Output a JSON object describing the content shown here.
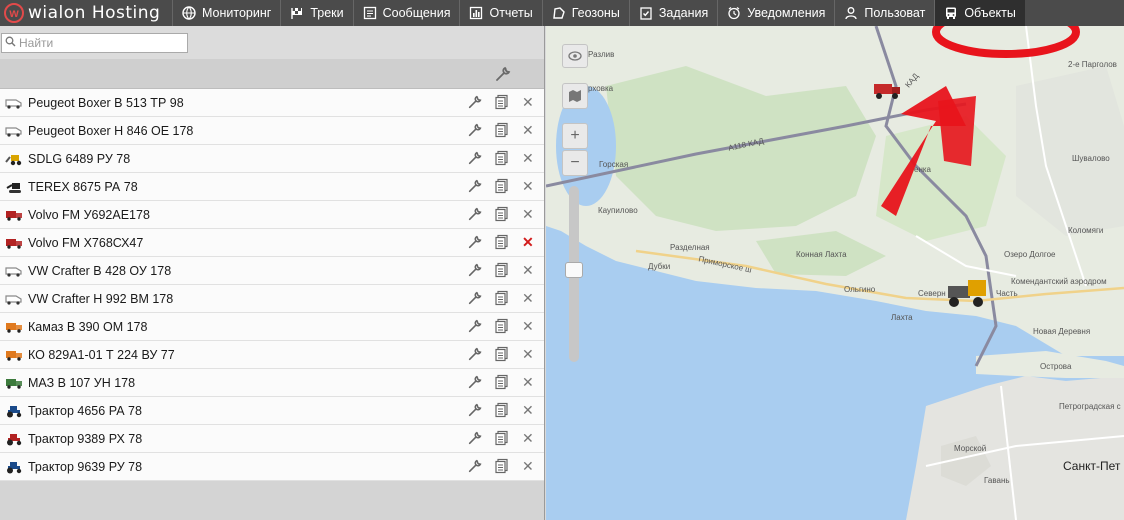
{
  "app": {
    "logo_text": "wialon Hosting"
  },
  "nav": [
    {
      "label": "Мониторинг",
      "icon": "globe-icon"
    },
    {
      "label": "Треки",
      "icon": "flag-icon"
    },
    {
      "label": "Сообщения",
      "icon": "message-icon"
    },
    {
      "label": "Отчеты",
      "icon": "report-icon"
    },
    {
      "label": "Геозоны",
      "icon": "geofence-icon"
    },
    {
      "label": "Задания",
      "icon": "tasks-icon"
    },
    {
      "label": "Уведомления",
      "icon": "alarm-icon"
    },
    {
      "label": "Пользоват",
      "icon": "user-icon"
    },
    {
      "label": "Объекты",
      "icon": "bus-icon",
      "active": true
    }
  ],
  "search": {
    "placeholder": "Найти",
    "value": ""
  },
  "units": [
    {
      "name": "Peugeot Boxer В 513 ТР 98",
      "icon": "van-icon",
      "color": "#8a8a8a"
    },
    {
      "name": "Peugeot Boxer Н 846 ОЕ 178",
      "icon": "van-icon",
      "color": "#8a8a8a"
    },
    {
      "name": "SDLG 6489 РУ 78",
      "icon": "loader-icon",
      "color": "#d9a400"
    },
    {
      "name": "TEREX 8675 РА 78",
      "icon": "excavator-icon",
      "color": "#222222"
    },
    {
      "name": "Volvo FM У692АЕ178",
      "icon": "truck-icon",
      "color": "#b22222"
    },
    {
      "name": "Volvo FM Х768СХ47",
      "icon": "truck-icon",
      "color": "#b22222",
      "delete_active": true
    },
    {
      "name": "VW Crafter В 428 ОУ 178",
      "icon": "van-icon",
      "color": "#8a8a8a"
    },
    {
      "name": "VW Crafter Н 992 ВМ 178",
      "icon": "van-icon",
      "color": "#8a8a8a"
    },
    {
      "name": "Камаз В 390 ОМ 178",
      "icon": "truck-icon",
      "color": "#e07a1f"
    },
    {
      "name": "КО 829А1-01 Т 224 ВУ 77",
      "icon": "truck-icon",
      "color": "#e07a1f"
    },
    {
      "name": "МАЗ В 107 УН 178",
      "icon": "truck-icon",
      "color": "#3c7a3c"
    },
    {
      "name": "Трактор 4656 РА 78",
      "icon": "tractor-icon",
      "color": "#1a4a8a"
    },
    {
      "name": "Трактор 9389 РХ 78",
      "icon": "tractor-icon",
      "color": "#b22222"
    },
    {
      "name": "Трактор 9639 РУ 78",
      "icon": "tractor-icon",
      "color": "#1a4a8a"
    }
  ],
  "map": {
    "labels": [
      "Разлив",
      "Тарховка",
      "Горская",
      "Каупилово",
      "Разделная",
      "Дубки",
      "Приморское ш",
      "Конная Лахта",
      "Ольгино",
      "Лахта",
      "Северн",
      "Часть",
      "Коломяги",
      "Озеро Долгое",
      "Комендантский аэродром",
      "Новая Деревня",
      "Острова",
      "Петроградская с",
      "Морской",
      "Гавань",
      "Санкт-Пет",
      "А118 КАД",
      "КАД",
      "енка",
      "Шувалово",
      "2-е Парголов"
    ],
    "zoom_in": "+",
    "zoom_out": "−"
  }
}
